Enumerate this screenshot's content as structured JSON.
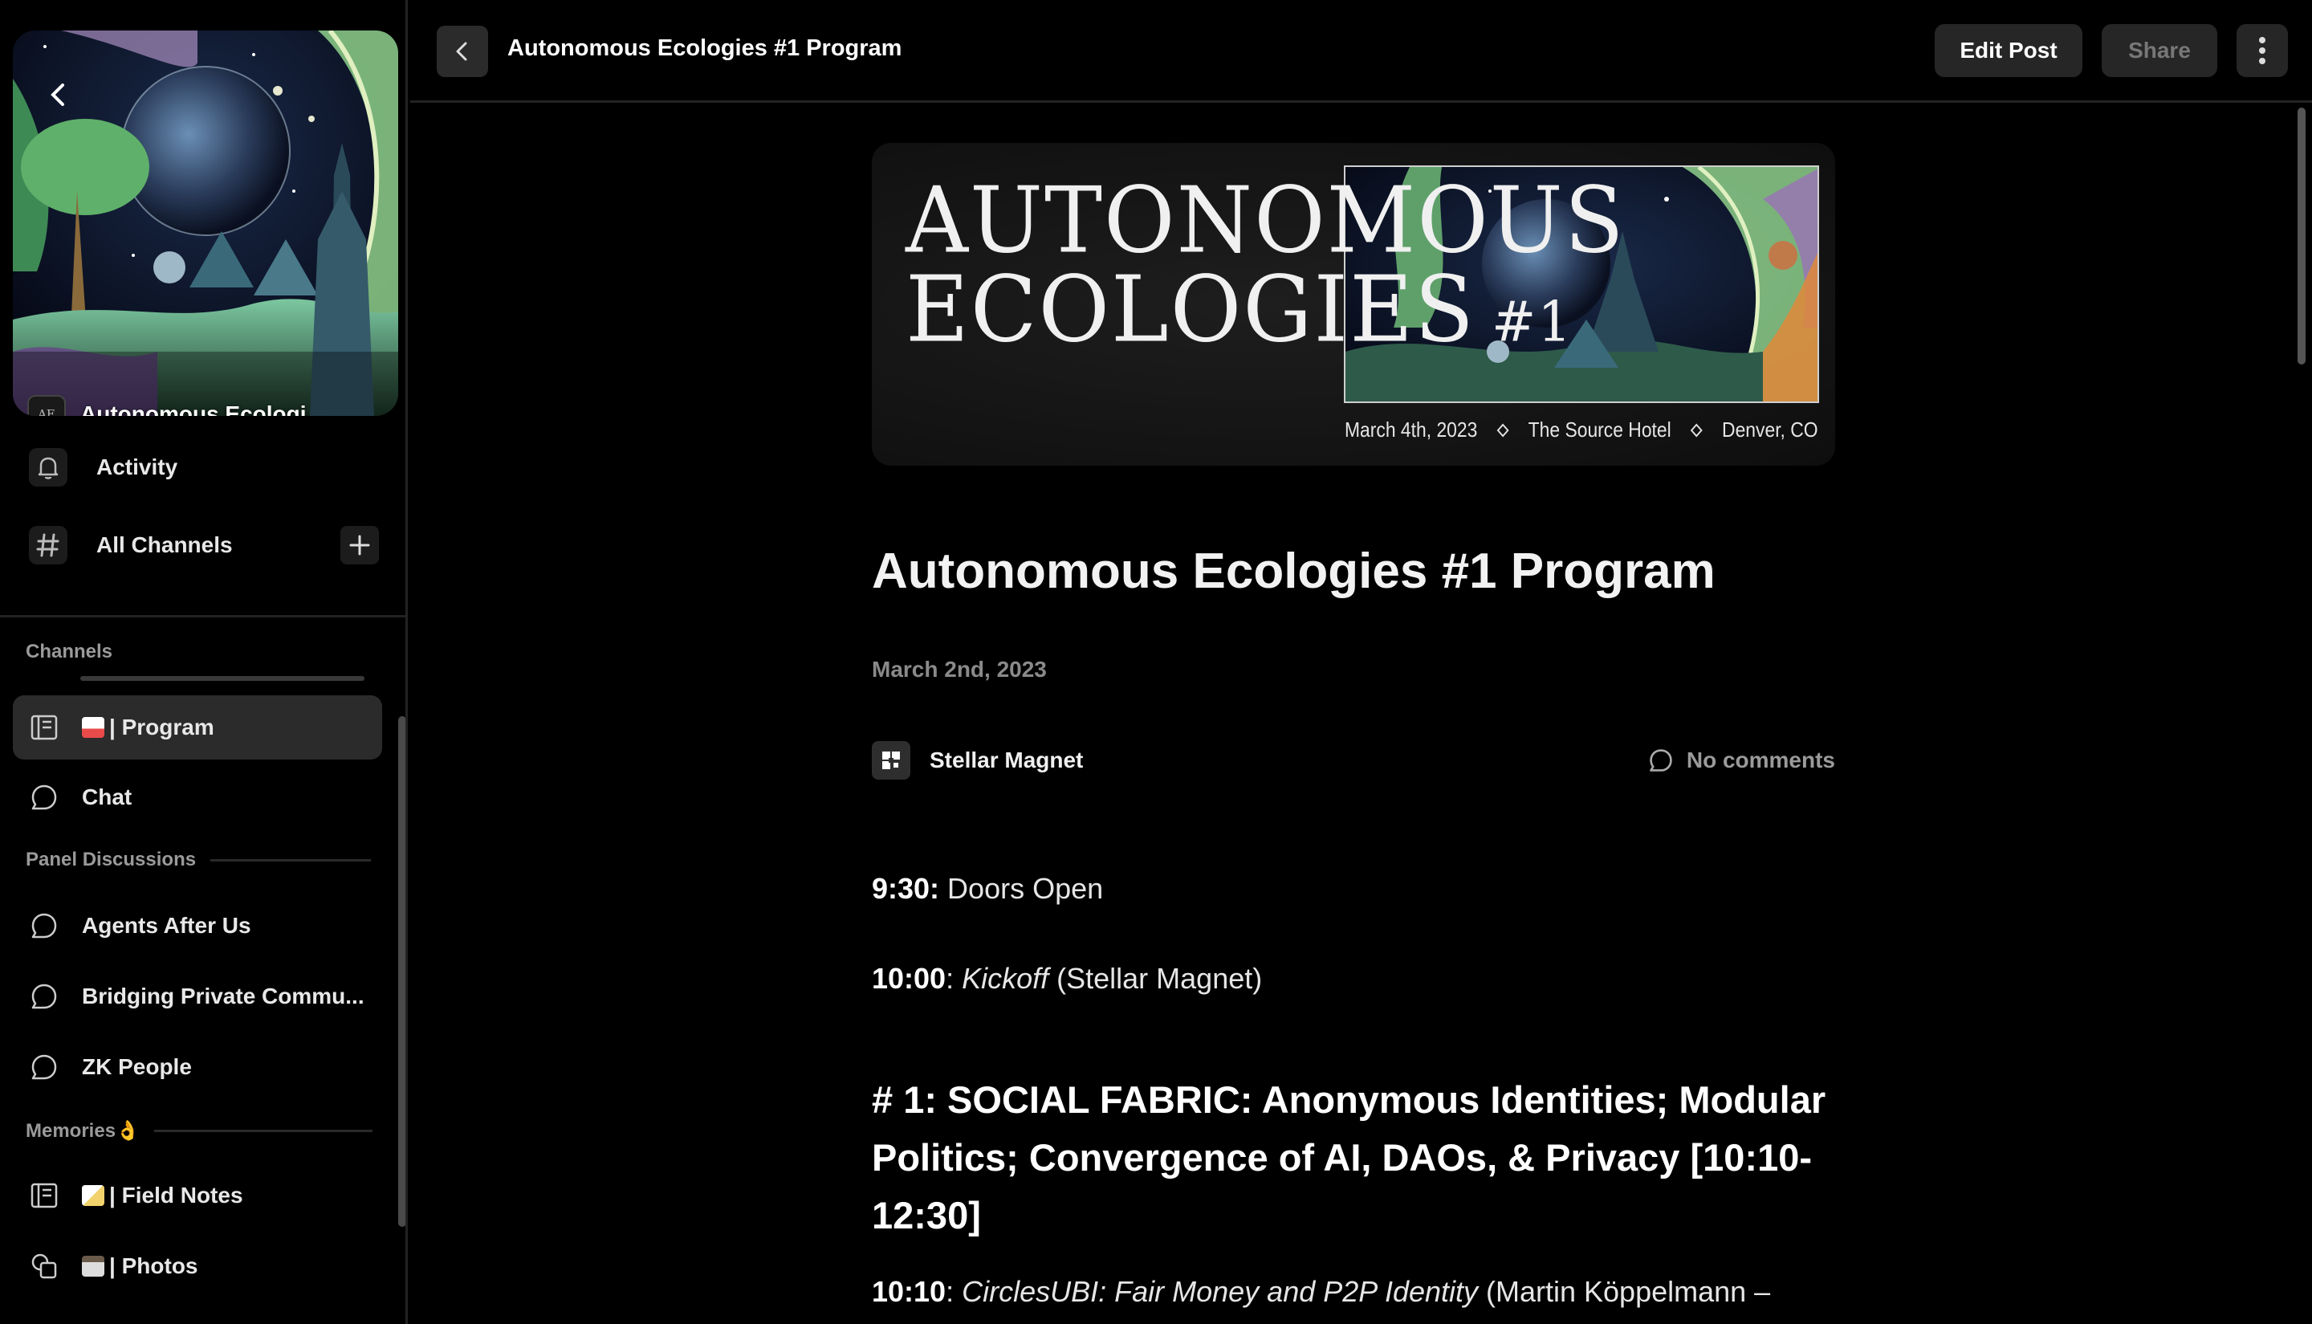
{
  "sidebar": {
    "group_name": "Autonomous Ecologi...",
    "group_avatar_text": "AE",
    "nav": {
      "activity": "Activity",
      "all_channels": "All Channels"
    },
    "sections": {
      "channels": "Channels",
      "panel_discussions": "Panel Discussions",
      "memories": "Memories👌"
    },
    "channels": [
      {
        "label": "| Program",
        "emoji_color": "#e94a4a",
        "active": true
      },
      {
        "label": "Chat"
      },
      {
        "label": "Agents After Us"
      },
      {
        "label": "Bridging Private Commu..."
      },
      {
        "label": "ZK People"
      },
      {
        "label": "| Field Notes",
        "emoji_color": "#f2d36b"
      },
      {
        "label": "| Photos",
        "emoji_color": "#8a7a6a"
      }
    ]
  },
  "topbar": {
    "title": "Autonomous Ecologies #1 Program",
    "edit_label": "Edit Post",
    "share_label": "Share"
  },
  "post": {
    "banner": {
      "line1": "AUTONOMOUS",
      "line2": "ECOLOGIES",
      "number": "#1",
      "date": "March 4th, 2023",
      "venue": "The Source Hotel",
      "city": "Denver, CO"
    },
    "title": "Autonomous Ecologies #1 Program",
    "date": "March 2nd, 2023",
    "author": "Stellar Magnet",
    "comments": "No comments",
    "schedule": [
      {
        "time": "9:30:",
        "text": " Doors Open"
      },
      {
        "time": "10:00",
        "sep": ": ",
        "title": "Kickoff",
        "text": " (Stellar Magnet)"
      }
    ],
    "section_heading": "# 1: SOCIAL FABRIC: Anonymous Identities; Modular Politics; Convergence of AI, DAOs, & Privacy [10:10-12:30]",
    "item_1010": {
      "time": "10:10",
      "sep": ": ",
      "title": "CirclesUBI: Fair Money and P2P Identity ",
      "text": "(Martin Köppelmann –"
    }
  },
  "colors": {
    "background": "#000000",
    "active_channel": "#2b2b2b",
    "button": "#262626",
    "muted_text": "#8a8a8a"
  }
}
